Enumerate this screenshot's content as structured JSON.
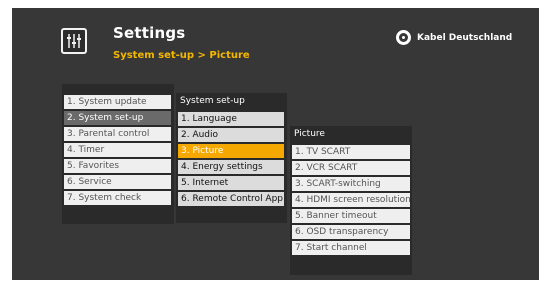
{
  "header": {
    "title": "Settings",
    "breadcrumb": "System set-up > Picture",
    "brand": "Kabel Deutschland",
    "settings_icon": "equalizer-sliders-icon",
    "brand_icon": "kabel-deutschland-logo"
  },
  "colors": {
    "accent": "#f5a800",
    "background": "#373737",
    "panel": "#2a2a2a"
  },
  "menu1": {
    "items": [
      "1. System update",
      "2. System set-up",
      "3. Parental control",
      "4. Timer",
      "5. Favorites",
      "6. Service",
      "7. System check"
    ],
    "active": "2. System set-up"
  },
  "menu2": {
    "header": "System set-up",
    "items": [
      "1. Language",
      "2. Audio",
      "3. Picture",
      "4. Energy settings",
      "5. Internet",
      "6. Remote Control App"
    ],
    "selected": "3. Picture"
  },
  "menu3": {
    "header": "Picture",
    "items": [
      "1. TV SCART",
      "2. VCR SCART",
      "3. SCART-switching",
      "4. HDMI screen resolution",
      "5. Banner timeout",
      "6. OSD transparency",
      "7. Start channel"
    ]
  }
}
